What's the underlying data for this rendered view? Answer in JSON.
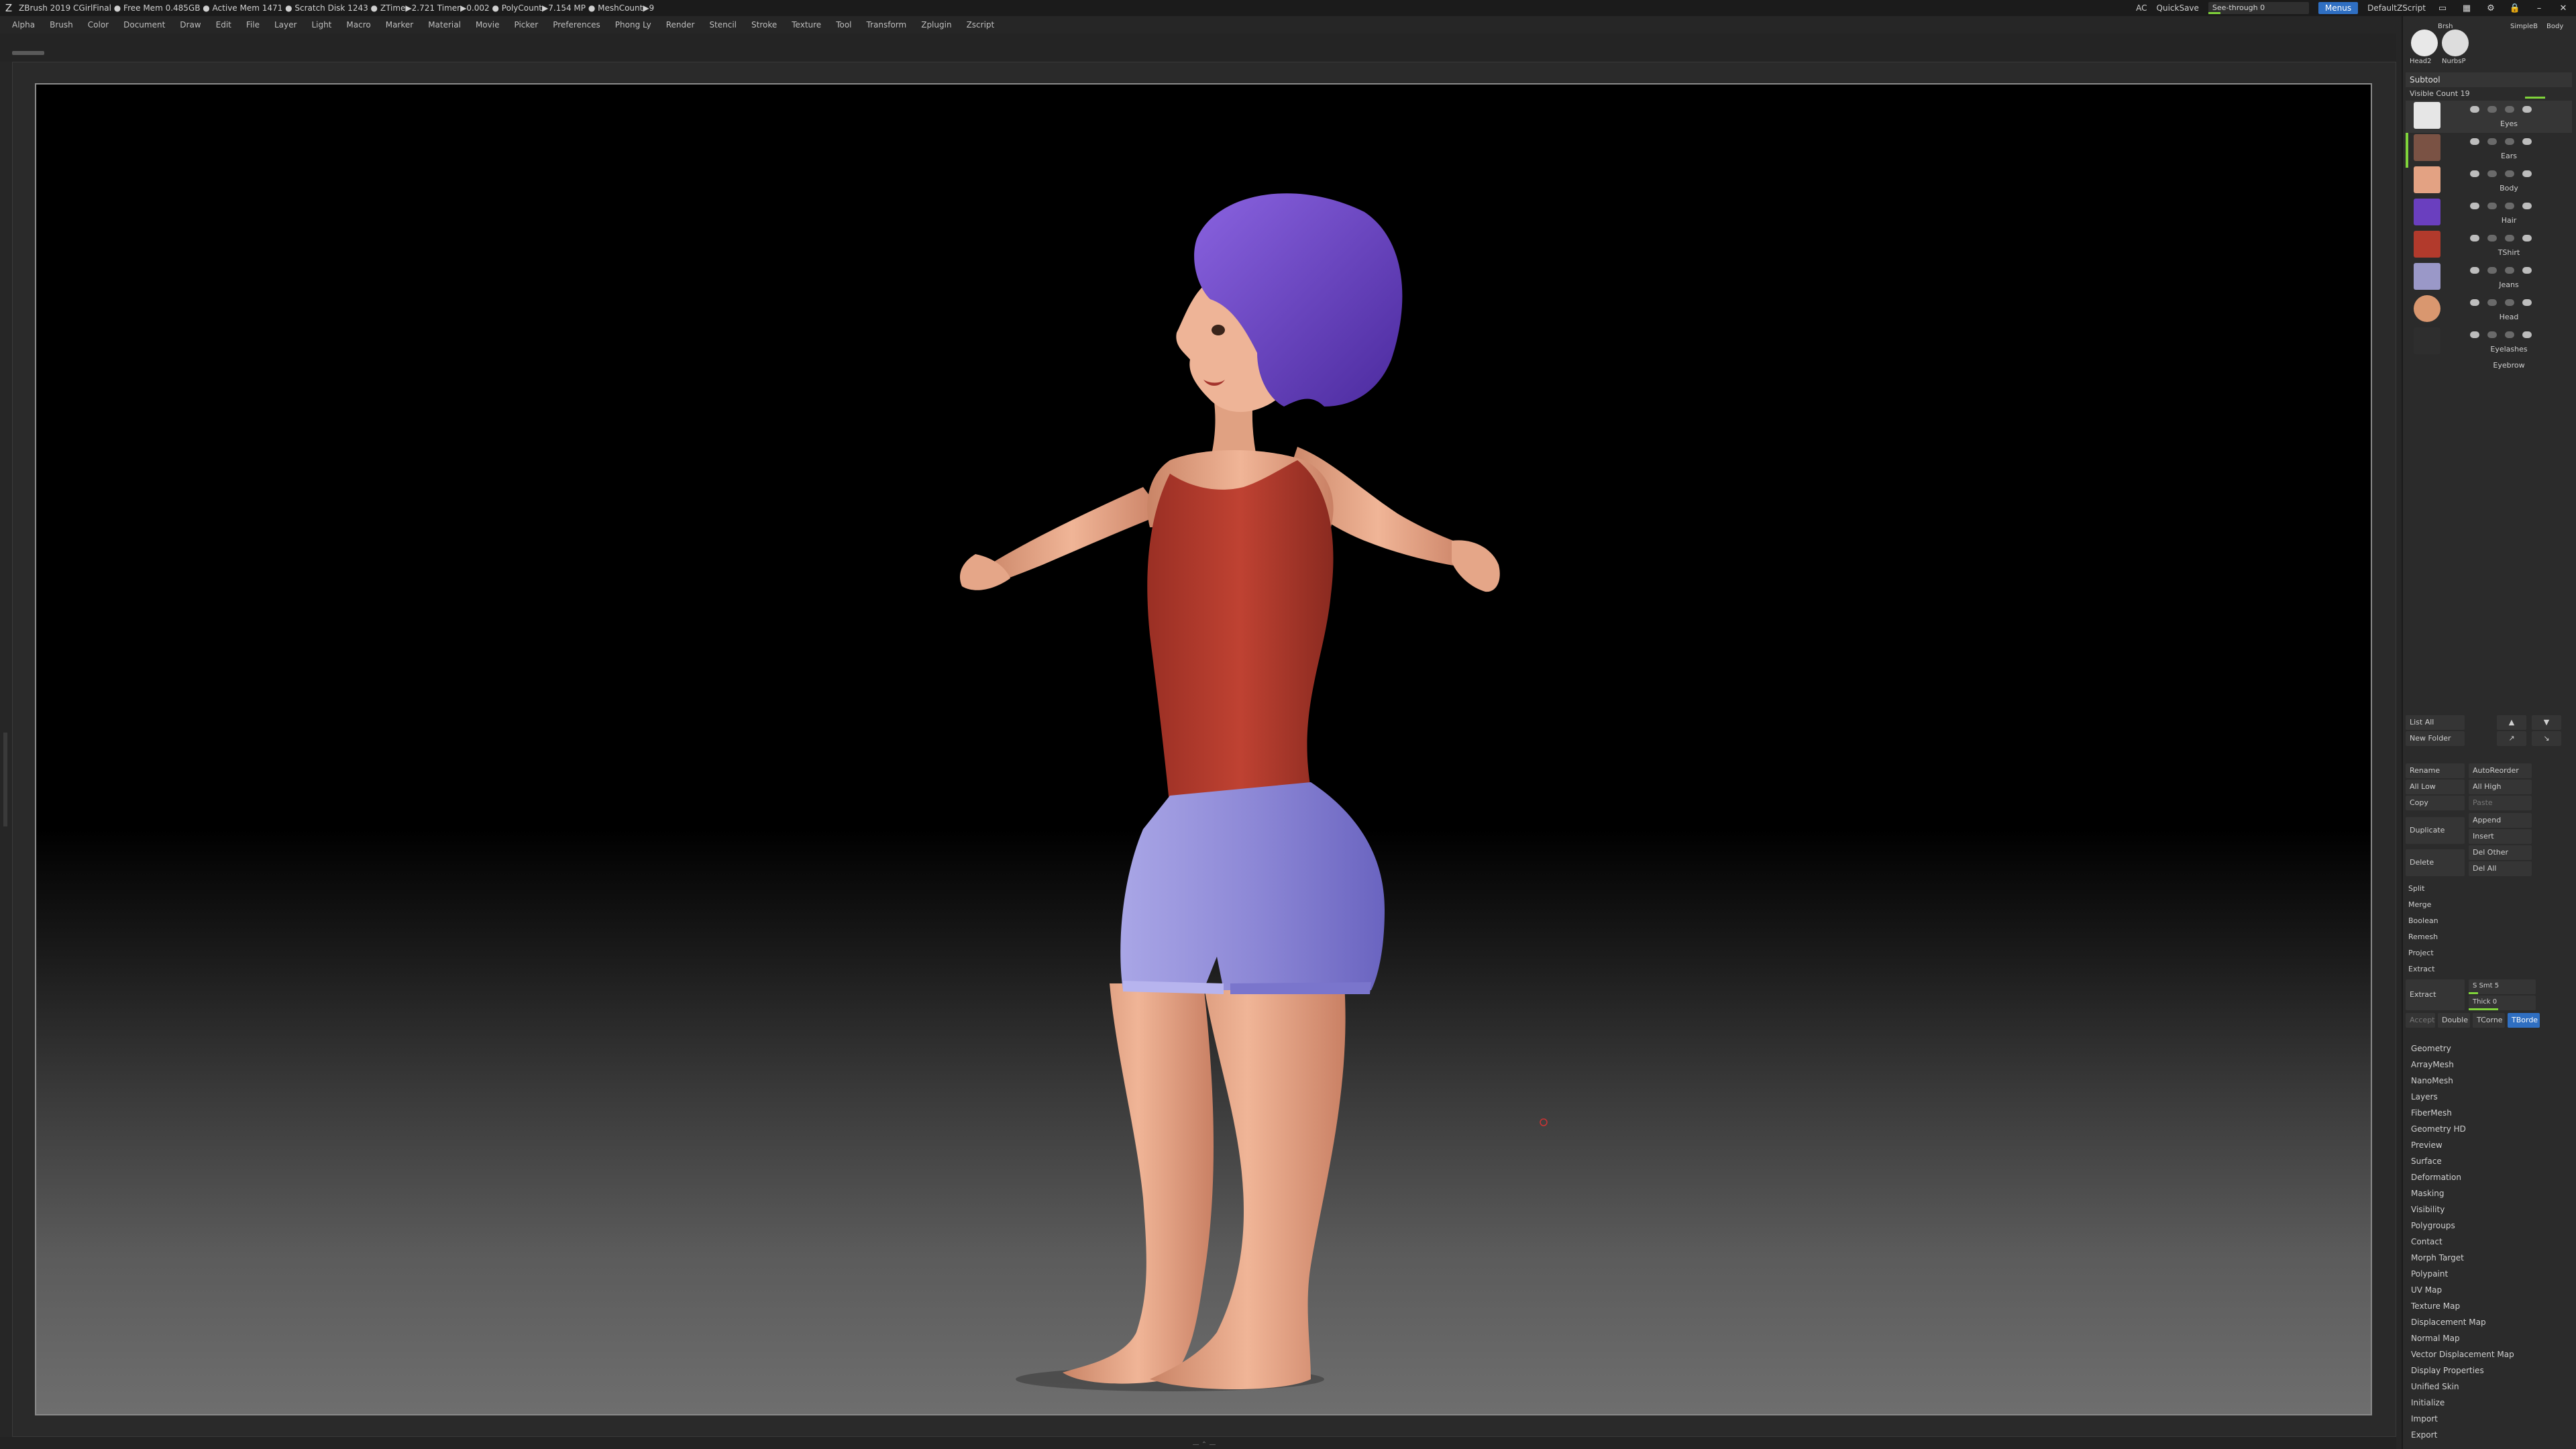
{
  "titlebar": {
    "title": "ZBrush 2019    CGirlFinal    ● Free Mem 0.485GB ● Active Mem 1471 ● Scratch Disk 1243 ●  ZTime▶2.721 Timer▶0.002 ● PolyCount▶7.154 MP  ● MeshCount▶9",
    "ac": "AC",
    "quicksave": "QuickSave",
    "see_through": "See-through  0",
    "menus": "Menus",
    "zscript": "DefaultZScript"
  },
  "menubar": [
    "Alpha",
    "Brush",
    "Color",
    "Document",
    "Draw",
    "Edit",
    "File",
    "Layer",
    "Light",
    "Macro",
    "Marker",
    "Material",
    "Movie",
    "Picker",
    "Preferences",
    "Phong Ly",
    "Render",
    "Stencil",
    "Stroke",
    "Texture",
    "Tool",
    "Transform",
    "Zplugin",
    "Zscript"
  ],
  "brushes": {
    "top_labels": [
      "Brsh",
      "SimpleB",
      "Body"
    ],
    "bottom_labels": [
      "Head2",
      "NurbsP"
    ]
  },
  "subtool": {
    "title": "Subtool",
    "visible_count": "Visible Count 19",
    "items": [
      {
        "name": "Eyes"
      },
      {
        "name": "Ears"
      },
      {
        "name": "Body"
      },
      {
        "name": "Hair"
      },
      {
        "name": "TShirt"
      },
      {
        "name": "Jeans"
      },
      {
        "name": "Head"
      },
      {
        "name": "Eyelashes"
      },
      {
        "name": "Eyebrow"
      }
    ]
  },
  "buttons": {
    "list_all": "List All",
    "new_folder": "New Folder",
    "rename": "Rename",
    "autoreorder": "AutoReorder",
    "all_low": "All Low",
    "all_high": "All High",
    "copy": "Copy",
    "paste": "Paste",
    "duplicate": "Duplicate",
    "append": "Append",
    "insert": "Insert",
    "delete": "Delete",
    "del_other": "Del Other",
    "del_all": "Del All",
    "split": "Split",
    "merge": "Merge",
    "boolean": "Boolean",
    "remesh": "Remesh",
    "project": "Project",
    "extract": "Extract",
    "extract2": "Extract",
    "s_smt": "S Smt  5",
    "thick": "Thick 0",
    "accept": "Accept",
    "double": "Double",
    "tcorne": "TCorne",
    "tborder": "TBorde"
  },
  "sections": [
    "Geometry",
    "ArrayMesh",
    "NanoMesh",
    "Layers",
    "FiberMesh",
    "Geometry HD",
    "Preview",
    "Surface",
    "Deformation",
    "Masking",
    "Visibility",
    "Polygroups",
    "Contact",
    "Morph Target",
    "Polypaint",
    "UV Map",
    "Texture Map",
    "Displacement Map",
    "Normal Map",
    "Vector Displacement Map",
    "Display Properties",
    "Unified Skin",
    "Initialize",
    "Import",
    "Export"
  ],
  "colors": {
    "accent_green": "#7fd33a",
    "accent_blue": "#2f6fc2",
    "skin": "#e8a98a",
    "shirt": "#b23a2c",
    "shorts": "#8f8ad6",
    "hair": "#6a3fbf"
  }
}
